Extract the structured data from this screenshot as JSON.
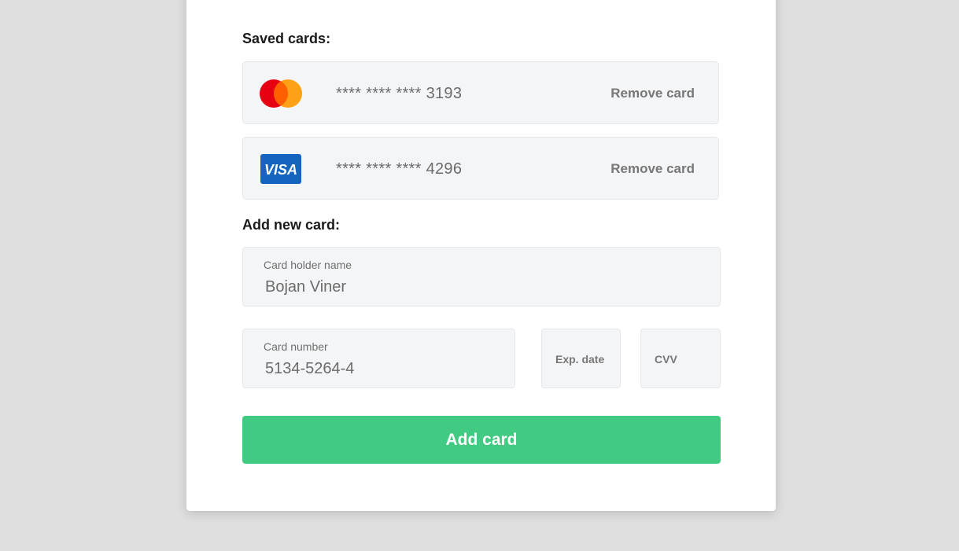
{
  "saved_cards": {
    "title": "Saved cards:",
    "items": [
      {
        "brand": "mastercard",
        "brand_colors": [
          "#eb001b",
          "#ff9a00"
        ],
        "masked_number": "**** **** **** 3193",
        "remove_label": "Remove card"
      },
      {
        "brand": "visa",
        "brand_text": "VISA",
        "brand_color": "#1565c0",
        "masked_number": "**** **** **** 4296",
        "remove_label": "Remove card"
      }
    ]
  },
  "new_card": {
    "title": "Add new card:",
    "holder_name": {
      "label": "Card holder name",
      "value": "Bojan Viner"
    },
    "card_number": {
      "label": "Card number",
      "value": "5134-5264-4"
    },
    "exp_date": {
      "placeholder": "Exp. date"
    },
    "cvv": {
      "placeholder": "CVV"
    },
    "submit_label": "Add card"
  },
  "colors": {
    "accent": "#41ca81",
    "background": "#dfdfdf",
    "panel": "#ffffff",
    "field_bg": "#f4f5f7"
  }
}
